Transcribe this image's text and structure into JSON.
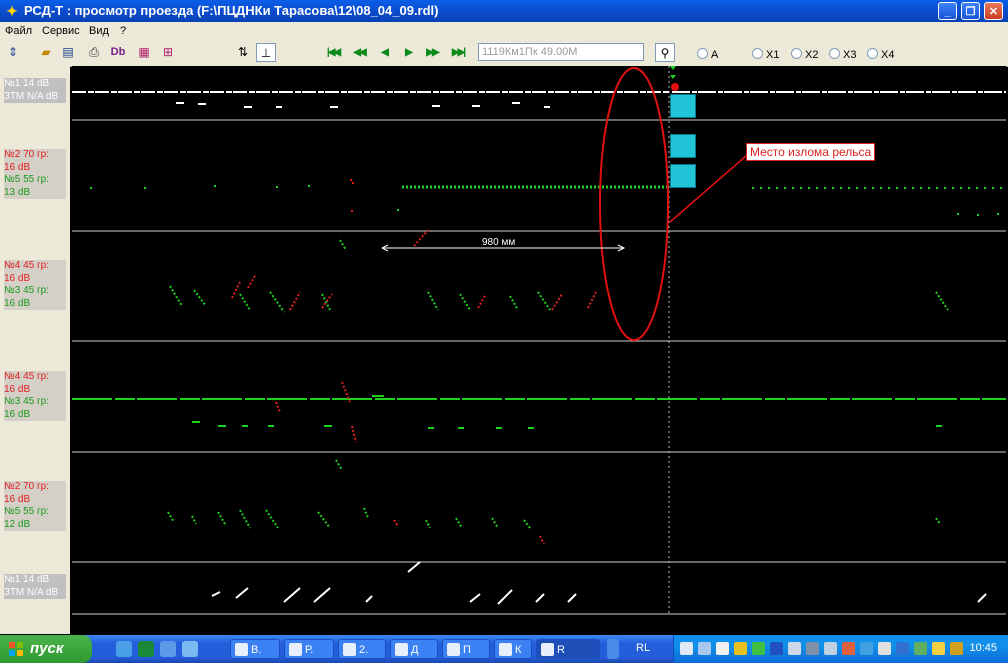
{
  "window": {
    "title": "РСД-Т : просмотр проезда (F:\\ПЦДНКи Тарасова\\12\\08_04_09.rdl)"
  },
  "menu": {
    "file": "Файл",
    "service": "Сервис",
    "view": "Вид",
    "help": "?"
  },
  "toolbar": {
    "position_value": "1119Км1Пк 49.00М",
    "radios": [
      "A",
      "X1",
      "X2",
      "X3",
      "X4"
    ],
    "db_label": "Db"
  },
  "channels": [
    {
      "lines": [
        {
          "text": "№1 14 dB",
          "color": "white"
        },
        {
          "text": "ЗТМ N/A dB",
          "color": "white"
        }
      ]
    },
    {
      "lines": [
        {
          "text": "№2 70 гр:",
          "color": "red"
        },
        {
          "text": "16 dB",
          "color": "red"
        },
        {
          "text": "№5 55 гр:",
          "color": "green"
        },
        {
          "text": "13 dB",
          "color": "green"
        }
      ]
    },
    {
      "lines": [
        {
          "text": "№4 45 гр:",
          "color": "red"
        },
        {
          "text": "16 dB",
          "color": "red"
        },
        {
          "text": "№3 45 гр:",
          "color": "green"
        },
        {
          "text": "16 dB",
          "color": "green"
        }
      ]
    },
    {
      "lines": [
        {
          "text": "№4 45 гр:",
          "color": "red"
        },
        {
          "text": "16 dB",
          "color": "red"
        },
        {
          "text": "№3 45 гр:",
          "color": "green"
        },
        {
          "text": "16 dB",
          "color": "green"
        }
      ]
    },
    {
      "lines": [
        {
          "text": "№2 70 гр:",
          "color": "red"
        },
        {
          "text": "16 dB",
          "color": "red"
        },
        {
          "text": "№5 55 гр:",
          "color": "green"
        },
        {
          "text": "12 dB",
          "color": "green"
        }
      ]
    },
    {
      "lines": [
        {
          "text": "№1 14 dB",
          "color": "white"
        },
        {
          "text": "ЗТМ N/A dB",
          "color": "white"
        }
      ]
    }
  ],
  "annotations": {
    "callout": "Место излома рельса",
    "distance": "980 мм"
  },
  "taskbar": {
    "start": "пуск",
    "tasks": [
      "В.",
      "Р.",
      "2.",
      "Д",
      "П",
      "К",
      "R"
    ],
    "tray_label": "RL",
    "clock": "10:45"
  },
  "colors": {
    "red": "#e02020",
    "green": "#1fd11f",
    "white": "#ffffff",
    "ellipse": "#e01010"
  }
}
